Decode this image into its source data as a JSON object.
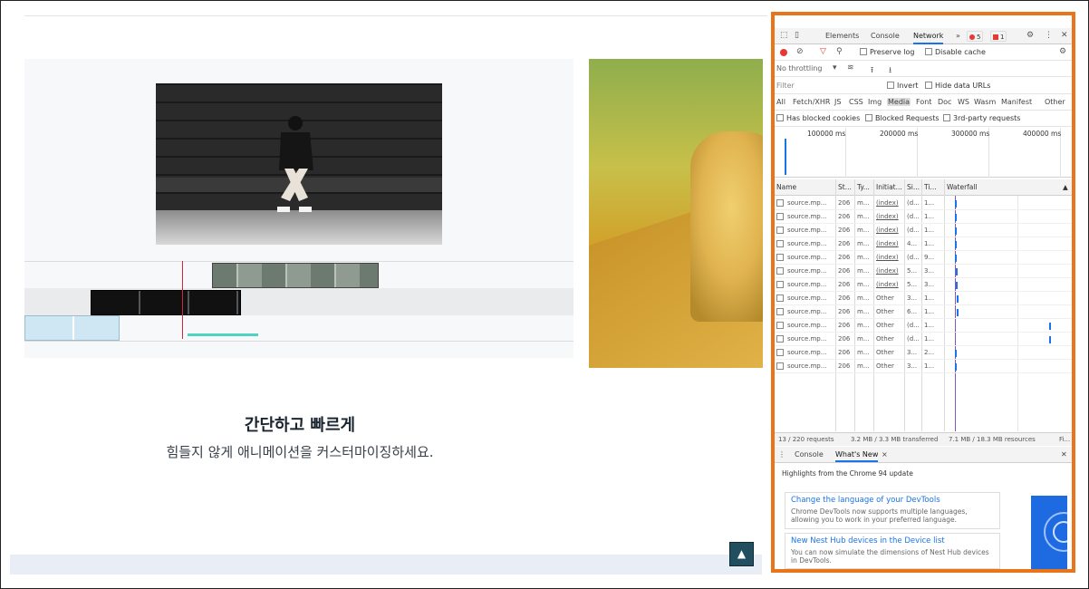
{
  "page": {
    "heading": "간단하고 빠르게",
    "subheading": "힘들지 않게 애니메이션을 커스터마이징하세요.",
    "scroll_top_icon": "▲"
  },
  "devtools": {
    "tabs": [
      "Elements",
      "Console",
      "Network"
    ],
    "more_tabs": "»",
    "errors_count": "5",
    "issues_count": "1",
    "toolbar": {
      "preserve_log": "Preserve log",
      "disable_cache": "Disable cache",
      "throttling": "No throttling"
    },
    "filter": {
      "placeholder": "Filter",
      "invert": "Invert",
      "hide_data_urls": "Hide data URLs",
      "types": [
        "All",
        "Fetch/XHR",
        "JS",
        "CSS",
        "Img",
        "Media",
        "Font",
        "Doc",
        "WS",
        "Wasm",
        "Manifest",
        "Other"
      ],
      "active_type": "Media",
      "has_blocked_cookies": "Has blocked cookies",
      "blocked_requests": "Blocked Requests",
      "third_party": "3rd-party requests"
    },
    "overview_ticks": [
      "100000 ms",
      "200000 ms",
      "300000 ms",
      "400000 ms"
    ],
    "columns": [
      "Name",
      "St...",
      "Ty...",
      "Initiat...",
      "Si...",
      "Ti...",
      "Waterfall"
    ],
    "requests": [
      {
        "name": "source.mp...",
        "status": "206",
        "type": "m...",
        "initiator": "(index)",
        "size": "(d...",
        "time": "1..."
      },
      {
        "name": "source.mp...",
        "status": "206",
        "type": "m...",
        "initiator": "(index)",
        "size": "(d...",
        "time": "1..."
      },
      {
        "name": "source.mp...",
        "status": "206",
        "type": "m...",
        "initiator": "(index)",
        "size": "(d...",
        "time": "1..."
      },
      {
        "name": "source.mp...",
        "status": "206",
        "type": "m...",
        "initiator": "(index)",
        "size": "4...",
        "time": "1..."
      },
      {
        "name": "source.mp...",
        "status": "206",
        "type": "m...",
        "initiator": "(index)",
        "size": "(d...",
        "time": "9..."
      },
      {
        "name": "source.mp...",
        "status": "206",
        "type": "m...",
        "initiator": "(index)",
        "size": "5...",
        "time": "3..."
      },
      {
        "name": "source.mp...",
        "status": "206",
        "type": "m...",
        "initiator": "(index)",
        "size": "5...",
        "time": "3..."
      },
      {
        "name": "source.mp...",
        "status": "206",
        "type": "m...",
        "initiator": "Other",
        "size": "3...",
        "time": "1..."
      },
      {
        "name": "source.mp...",
        "status": "206",
        "type": "m...",
        "initiator": "Other",
        "size": "6...",
        "time": "1..."
      },
      {
        "name": "source.mp...",
        "status": "206",
        "type": "m...",
        "initiator": "Other",
        "size": "(d...",
        "time": "1..."
      },
      {
        "name": "source.mp...",
        "status": "206",
        "type": "m...",
        "initiator": "Other",
        "size": "(d...",
        "time": "1..."
      },
      {
        "name": "source.mp...",
        "status": "206",
        "type": "m...",
        "initiator": "Other",
        "size": "3...",
        "time": "2..."
      },
      {
        "name": "source.mp...",
        "status": "206",
        "type": "m...",
        "initiator": "Other",
        "size": "3...",
        "time": "1..."
      }
    ],
    "status": {
      "requests": "13 / 220 requests",
      "transferred": "3.2 MB / 3.3 MB transferred",
      "resources": "7.1 MB / 18.3 MB resources",
      "finish": "Fi..."
    },
    "drawer": {
      "tabs": [
        "Console",
        "What's New"
      ],
      "close": "×",
      "highlights": "Highlights from the Chrome 94 update",
      "news": [
        {
          "title": "Change the language of your DevTools",
          "desc": "Chrome DevTools now supports multiple languages, allowing you to work in your preferred language."
        },
        {
          "title": "New Nest Hub devices in the Device list",
          "desc": "You can now simulate the dimensions of Nest Hub devices in DevTools."
        }
      ]
    },
    "colors": {
      "highlight_border": "#e8751a",
      "accent": "#1a73e8",
      "error": "#e53935"
    }
  }
}
